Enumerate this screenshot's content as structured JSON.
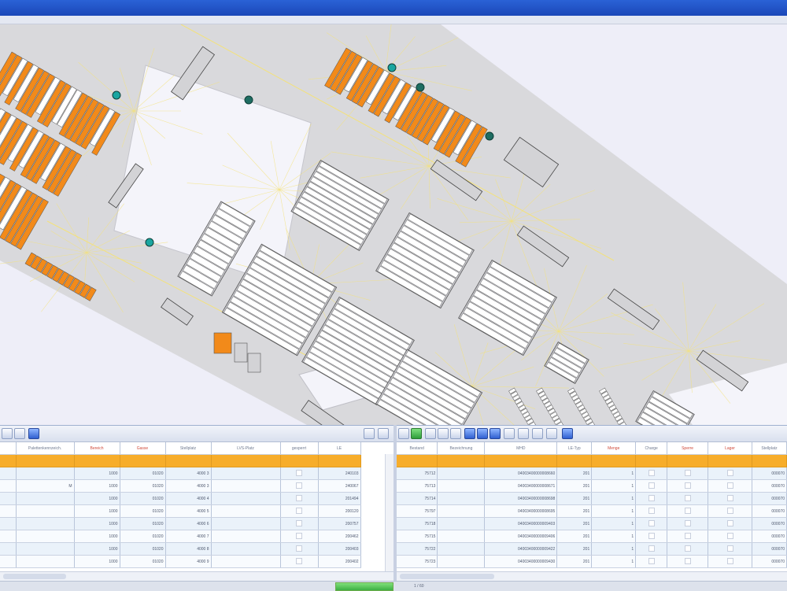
{
  "window": {
    "accent": "#1f4fc4"
  },
  "map": {
    "background": "#eeeef8",
    "floor_color": "#d9d9dc",
    "rack_color": "#ffffff",
    "occupied_color": "#f28a1a",
    "path_color": "#f4e27a",
    "vehicle_color_a": "#1aa6a0",
    "vehicle_color_b": "#1f6d62",
    "vehicle_count": 6
  },
  "left_table": {
    "columns": [
      "",
      "Palettenkennzeich.",
      "Bereich",
      "Gasse",
      "Stellplatz",
      "LVS-Platz",
      "gesperrt",
      "LE"
    ],
    "red_columns": [
      2,
      3
    ],
    "filter_row": [
      "",
      "",
      "",
      "",
      "",
      "",
      "",
      ""
    ],
    "rows": [
      [
        "",
        "",
        "1000",
        "01020",
        "4000 3",
        "",
        "",
        "240103"
      ],
      [
        "",
        "",
        "1000",
        "01020",
        "4000 3",
        "",
        "",
        "240067"
      ],
      [
        "",
        "",
        "1000",
        "01020",
        "4000 4",
        "",
        "",
        "201494"
      ],
      [
        "",
        "",
        "1000",
        "01020",
        "4000 5",
        "",
        "",
        "200120"
      ],
      [
        "",
        "",
        "1000",
        "01020",
        "4000 6",
        "",
        "",
        "200757"
      ],
      [
        "",
        "",
        "1000",
        "01020",
        "4000 7",
        "",
        "",
        "200462"
      ],
      [
        "",
        "",
        "1000",
        "01020",
        "4000 8",
        "",
        "",
        "200403"
      ],
      [
        "",
        "",
        "1000",
        "01020",
        "4000 9",
        "",
        "",
        "200402"
      ]
    ],
    "selected_row_index": 1,
    "selected_mark": "M"
  },
  "right_table": {
    "columns": [
      "Bestand",
      "Bezeichnung",
      "MHD",
      "LE-Typ",
      "Menge",
      "Charge",
      "Sperre",
      "Lager",
      "Stellplatz"
    ],
    "red_columns": [
      4,
      6,
      7
    ],
    "filter_row": [
      "",
      "",
      "",
      "",
      "",
      "",
      "",
      "",
      ""
    ],
    "rows": [
      [
        "75712",
        "",
        "04003400000008660",
        "201",
        "1",
        "",
        "",
        "",
        "000070"
      ],
      [
        "75713",
        "",
        "04003400000008671",
        "201",
        "1",
        "",
        "",
        "",
        "000070"
      ],
      [
        "75714",
        "",
        "04003400000008698",
        "201",
        "1",
        "",
        "",
        "",
        "000070"
      ],
      [
        "75797",
        "",
        "04003400000008695",
        "201",
        "1",
        "",
        "",
        "",
        "000070"
      ],
      [
        "75718",
        "",
        "04003400000009403",
        "201",
        "1",
        "",
        "",
        "",
        "000070"
      ],
      [
        "75715",
        "",
        "04003400000009406",
        "201",
        "1",
        "",
        "",
        "",
        "000070"
      ],
      [
        "75722",
        "",
        "04003400000009422",
        "201",
        "1",
        "",
        "",
        "",
        "000070"
      ],
      [
        "75723",
        "",
        "04003400000009430",
        "201",
        "1",
        "",
        "",
        "",
        "000070"
      ]
    ]
  },
  "status": {
    "progress_fraction": 1.0,
    "right_text": "1 / 60"
  },
  "colors": {
    "header_orange": "#f7ad2a",
    "row_alt": "#eaf2fa",
    "progress_green": "#3cb043"
  }
}
